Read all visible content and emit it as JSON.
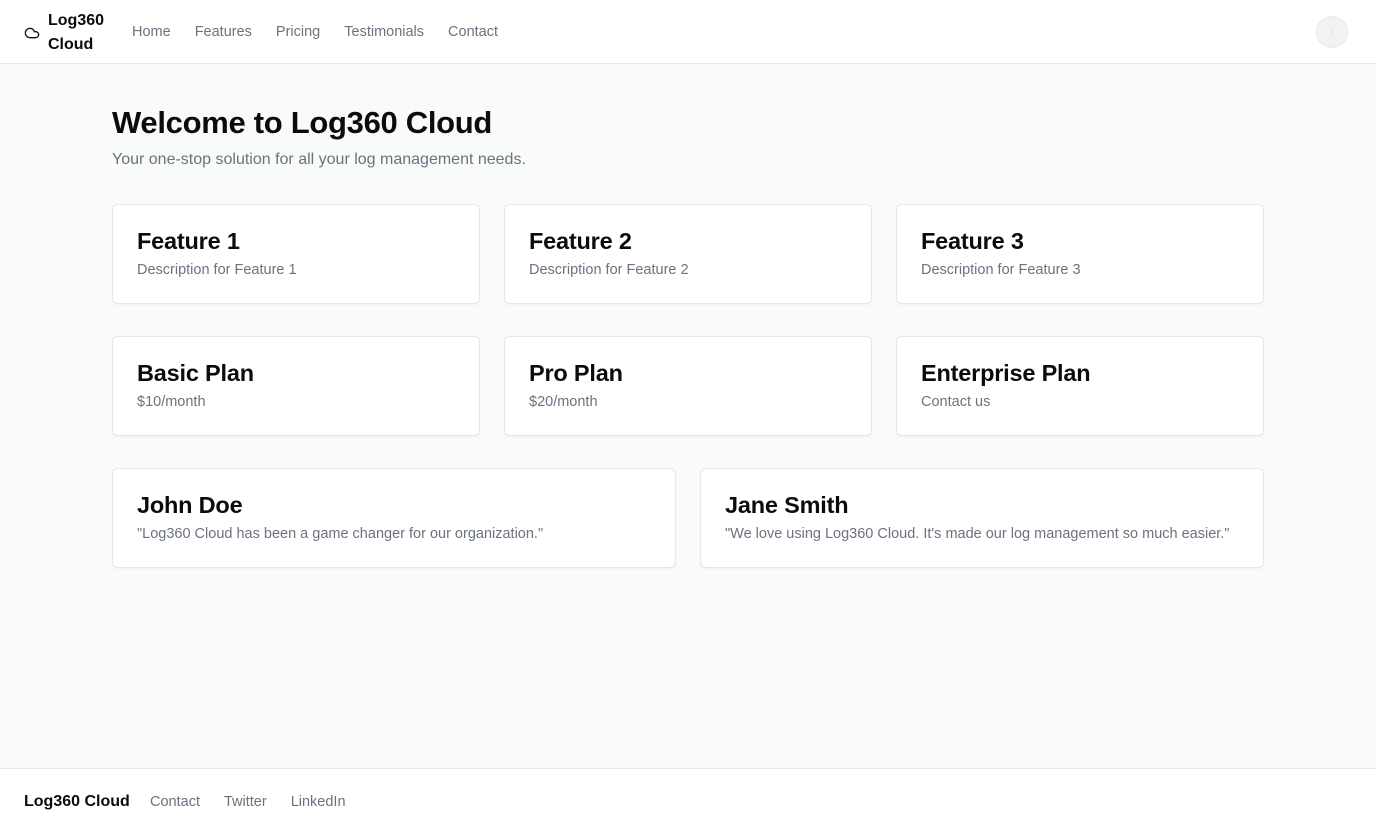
{
  "header": {
    "brand": "Log360 Cloud",
    "brand_icon": "cloud-icon",
    "nav": [
      "Home",
      "Features",
      "Pricing",
      "Testimonials",
      "Contact"
    ],
    "avatar_icon": "user-avatar"
  },
  "hero": {
    "title": "Welcome to Log360 Cloud",
    "subtitle": "Your one-stop solution for all your log management needs."
  },
  "features": [
    {
      "title": "Feature 1",
      "description": "Description for Feature 1"
    },
    {
      "title": "Feature 2",
      "description": "Description for Feature 2"
    },
    {
      "title": "Feature 3",
      "description": "Description for Feature 3"
    }
  ],
  "pricing": [
    {
      "title": "Basic Plan",
      "price": "$10/month"
    },
    {
      "title": "Pro Plan",
      "price": "$20/month"
    },
    {
      "title": "Enterprise Plan",
      "price": "Contact us"
    }
  ],
  "testimonials": [
    {
      "name": "John Doe",
      "quote": "\"Log360 Cloud has been a game changer for our organization.\""
    },
    {
      "name": "Jane Smith",
      "quote": "\"We love using Log360 Cloud. It's made our log management so much easier.\""
    }
  ],
  "footer": {
    "brand": "Log360 Cloud",
    "links": [
      "Contact",
      "Twitter",
      "LinkedIn"
    ]
  },
  "colors": {
    "background": "#f9fafa",
    "surface": "#ffffff",
    "text": "#0b0b0c",
    "muted": "#6b7280",
    "border": "#e5e7eb"
  }
}
